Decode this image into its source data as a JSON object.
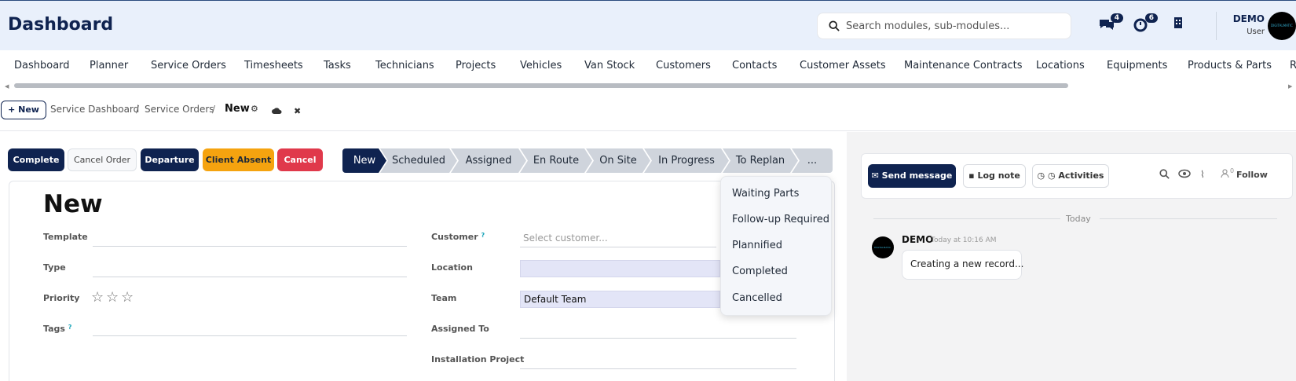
{
  "header": {
    "title": "Dashboard",
    "search_placeholder": "Search modules, sub-modules...",
    "messages_badge": "4",
    "activity_badge": "6",
    "user_name": "DEMO",
    "user_role": "User",
    "avatar_text": "DIGITALMATIC",
    "icons": [
      "search-icon",
      "chat-icon",
      "clock-icon",
      "building-icon"
    ]
  },
  "nav": {
    "items": [
      "Dashboard",
      "Planner",
      "Service Orders",
      "Timesheets",
      "Tasks",
      "Technicians",
      "Projects",
      "Vehicles",
      "Van Stock",
      "Customers",
      "Contacts",
      "Customer Assets",
      "Maintenance Contracts",
      "Locations",
      "Equipments",
      "Products & Parts",
      "R"
    ]
  },
  "breadcrumb": {
    "new_label": "+ New",
    "items": [
      "Service Dashboard",
      "Service Orders"
    ],
    "separator": "/",
    "current": "New"
  },
  "actions": {
    "complete": "Complete",
    "cancel_order": "Cancel Order",
    "departure": "Departure",
    "client_absent": "Client Absent",
    "cancel": "Cancel"
  },
  "pipeline": {
    "stages": [
      "New",
      "Scheduled",
      "Assigned",
      "En Route",
      "On Site",
      "In Progress",
      "To Replan",
      "..."
    ],
    "active": "New"
  },
  "form": {
    "title": "New",
    "template_label": "Template",
    "type_label": "Type",
    "priority_label": "Priority",
    "priority_stars": 0,
    "priority_max": 3,
    "tags_label": "Tags",
    "help_mark": "?",
    "customer_label": "Customer",
    "customer_placeholder": "Select customer...",
    "location_label": "Location",
    "team_label": "Team",
    "team_value": "Default Team",
    "assigned_label": "Assigned To",
    "installation_label": "Installation Project"
  },
  "dropdown": {
    "items": [
      "Waiting Parts",
      "Follow-up Required",
      "Plannified",
      "Completed",
      "Cancelled"
    ]
  },
  "chatter": {
    "send_message": "Send message",
    "log_note": "Log note",
    "activities": "Activities",
    "followers_count": "0",
    "follow": "Follow",
    "today": "Today",
    "message_author": "DEMO",
    "message_time": "Today at 10:16 AM",
    "message_text": "Creating a new record..."
  },
  "colors": {
    "brand": "#0f2350",
    "accent_orange": "#f5a30f",
    "danger": "#e0394b",
    "header_bg": "#e9f0fb"
  }
}
